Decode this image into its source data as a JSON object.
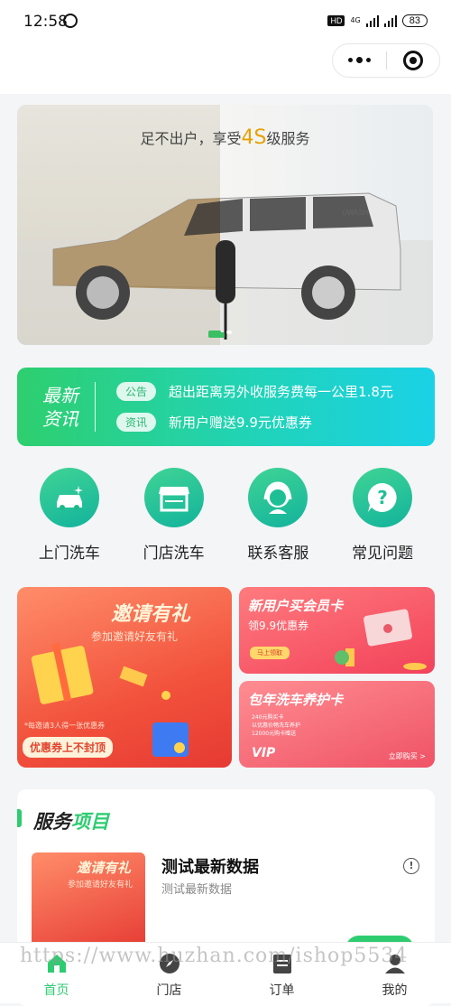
{
  "status_bar": {
    "time": "12:58",
    "network": "4G",
    "battery": "83"
  },
  "banner": {
    "slogan_pre": "足不出户，享受",
    "slogan_hl": "4S",
    "slogan_post": "级服务",
    "car_plate": "UWASH"
  },
  "news": {
    "logo_line1": "最新",
    "logo_line2": "资讯",
    "items": [
      {
        "tag": "公告",
        "text": "超出距离另外收服务费每一公里1.8元"
      },
      {
        "tag": "资讯",
        "text": "新用户赠送9.9元优惠券"
      }
    ]
  },
  "quick_actions": [
    {
      "label": "上门洗车",
      "icon": "car-wash-icon"
    },
    {
      "label": "门店洗车",
      "icon": "store-icon"
    },
    {
      "label": "联系客服",
      "icon": "customer-service-icon"
    },
    {
      "label": "常见问题",
      "icon": "question-icon"
    }
  ],
  "promos": {
    "invite": {
      "title": "邀请有礼",
      "subtitle": "参加邀请好友有礼",
      "note": "*每邀请3人得一张优惠券",
      "pill": "优惠券上不封顶"
    },
    "member": {
      "title": "新用户买会员卡",
      "subtitle": "领9.9优惠券",
      "button": "马上领取"
    },
    "package": {
      "title": "包年洗车养护卡",
      "line1": "240元购买卡",
      "line2": "以优惠价畅洗车养护",
      "line3": "12000元购卡赠送",
      "vip": "VIP",
      "buy": "立即购买 >"
    }
  },
  "services": {
    "title_a": "服务",
    "title_b": "项目",
    "items": [
      {
        "name": "测试最新数据",
        "desc": "测试最新数据",
        "thumb_title": "邀请有礼",
        "thumb_sub": "参加邀请好友有礼"
      }
    ]
  },
  "tabbar": [
    {
      "label": "首页",
      "icon": "home-icon",
      "active": true
    },
    {
      "label": "门店",
      "icon": "compass-icon",
      "active": false
    },
    {
      "label": "订单",
      "icon": "order-icon",
      "active": false
    },
    {
      "label": "我的",
      "icon": "user-icon",
      "active": false
    }
  ],
  "watermark": "https://www.huzhan.com/ishop5534",
  "colors": {
    "accent": "#2ecc71",
    "promo_red": "#f2523c"
  }
}
